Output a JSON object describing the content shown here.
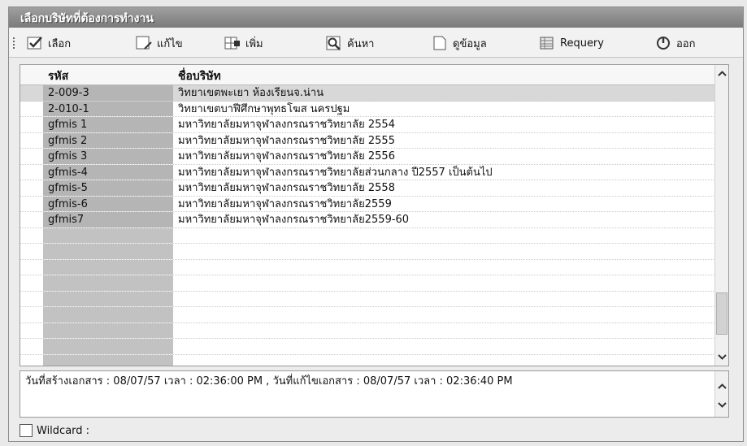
{
  "window": {
    "title": "เลือกบริษัทที่ต้องการทำงาน"
  },
  "toolbar": {
    "items": [
      {
        "label": "เลือก",
        "icon": "check-select-icon"
      },
      {
        "label": "แก้ไข",
        "icon": "edit-icon"
      },
      {
        "label": "เพิ่ม",
        "icon": "add-grid-icon"
      },
      {
        "label": "ค้นหา",
        "icon": "search-icon"
      },
      {
        "label": "ดูข้อมูล",
        "icon": "document-icon"
      },
      {
        "label": "Requery",
        "icon": "requery-grid-icon"
      },
      {
        "label": "ออก",
        "icon": "power-icon"
      }
    ]
  },
  "grid": {
    "headers": {
      "code": "รหัส",
      "name": "ชื่อบริษัท"
    },
    "rows": [
      {
        "code": "2-009-3",
        "name": "วิทยาเขตพะเยา ห้องเรียนจ.น่าน"
      },
      {
        "code": "2-010-1",
        "name": "วิทยาเขตบาฬีศึกษาพุทธโฆส นครปฐม"
      },
      {
        "code": "gfmis 1",
        "name": "มหาวิทยาลัยมหาจุฬาลงกรณราชวิทยาลัย 2554"
      },
      {
        "code": "gfmis 2",
        "name": "มหาวิทยาลัยมหาจุฬาลงกรณราชวิทยาลัย 2555"
      },
      {
        "code": "gfmis 3",
        "name": "มหาวิทยาลัยมหาจุฬาลงกรณราชวิทยาลัย 2556"
      },
      {
        "code": "gfmis-4",
        "name": "มหาวิทยาลัยมหาจุฬาลงกรณราชวิทยาลัยส่วนกลาง ปี2557 เป็นต้นไป"
      },
      {
        "code": "gfmis-5",
        "name": "มหาวิทยาลัยมหาจุฬาลงกรณราชวิทยาลัย 2558"
      },
      {
        "code": "gfmis-6",
        "name": "มหาวิทยาลัยมหาจุฬาลงกรณราชวิทยาลัย2559"
      },
      {
        "code": "gfmis7",
        "name": "มหาวิทยาลัยมหาจุฬาลงกรณราชวิทยาลัย2559-60"
      }
    ],
    "selected_row": 0
  },
  "memo": {
    "text": "วันที่สร้างเอกสาร : 08/07/57 เวลา : 02:36:00 PM , วันที่แก้ไขเอกสาร : 08/07/57 เวลา : 02:36:40 PM"
  },
  "wildcard": {
    "label": "Wildcard :",
    "checked": false
  }
}
